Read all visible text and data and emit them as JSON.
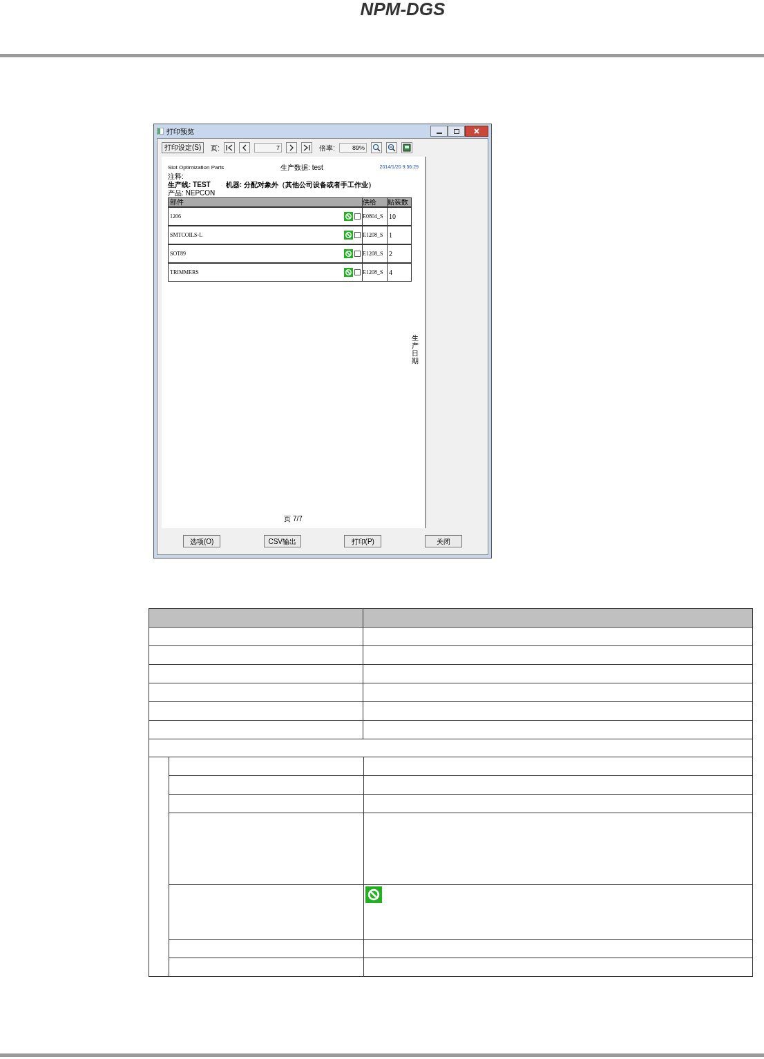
{
  "header": {
    "title": "NPM-DGS"
  },
  "window": {
    "title": "打印预览"
  },
  "toolbar": {
    "setup_button": "打印设定(S)",
    "page_label": "页:",
    "page_value": "7",
    "zoom_label": "倍率:",
    "zoom_value": "89%"
  },
  "report": {
    "app_name": "Slot Optimization Parts",
    "center": "生产数据: test",
    "datetime": "2014/1/20 9:56:29",
    "note": "注释:",
    "line": "生产线: TEST",
    "machine": "机器: 分配对象外（其他公司设备或者手工作业）",
    "product": "产品: NEPCON",
    "columns": [
      "部件",
      "供给",
      "贴装数"
    ],
    "rows": [
      {
        "part": "1206",
        "slot": "E0804_S",
        "count": "10"
      },
      {
        "part": "SMTCOILS-L",
        "slot": "E1208_S",
        "count": "1"
      },
      {
        "part": "SOT89",
        "slot": "E1208_S",
        "count": "2"
      },
      {
        "part": "TRIMMERS",
        "slot": "E1208_S",
        "count": "4"
      }
    ],
    "side_text": "生产日期",
    "page": "页 7/7"
  },
  "buttons": [
    "选项(O)",
    "CSV输出",
    "打印(P)",
    "关闭"
  ]
}
